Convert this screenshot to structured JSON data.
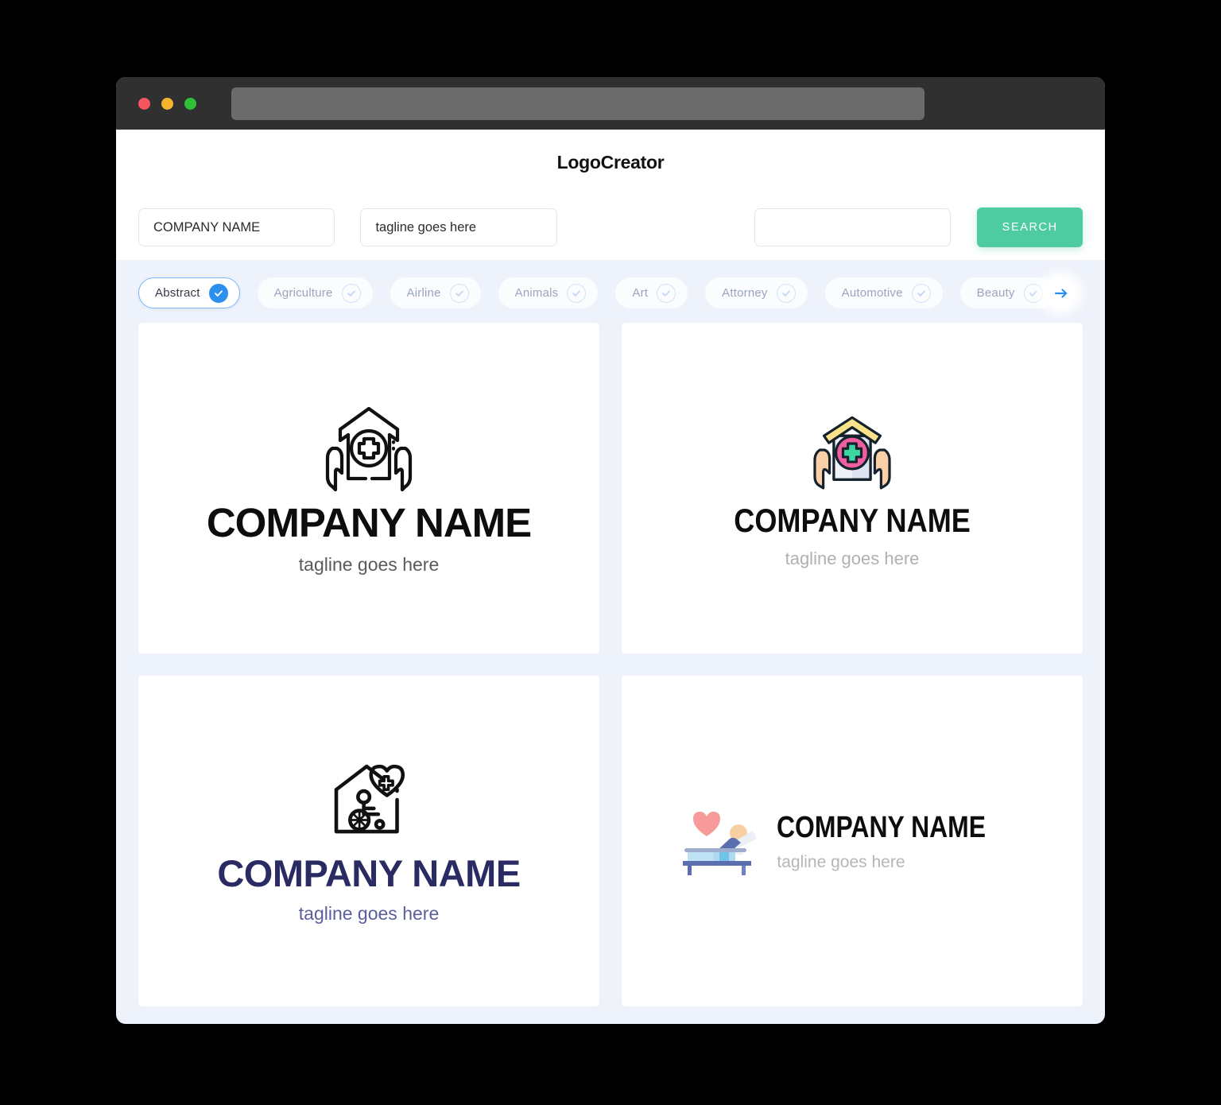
{
  "window": {
    "traffic_lights": [
      "close-red",
      "minimize-yellow",
      "maximize-green"
    ],
    "url_bar_value": ""
  },
  "header": {
    "brand": "LogoCreator"
  },
  "search": {
    "company_value": "COMPANY NAME",
    "tagline_value": "tagline goes here",
    "third_value": "",
    "search_label": "SEARCH",
    "accent_color": "#4ecba0"
  },
  "chips": {
    "selected_color": "#2b90f0",
    "items": [
      {
        "label": "Abstract",
        "selected": true
      },
      {
        "label": "Agriculture",
        "selected": false
      },
      {
        "label": "Airline",
        "selected": false
      },
      {
        "label": "Animals",
        "selected": false
      },
      {
        "label": "Art",
        "selected": false
      },
      {
        "label": "Attorney",
        "selected": false
      },
      {
        "label": "Automotive",
        "selected": false
      },
      {
        "label": "Beauty",
        "selected": false
      }
    ],
    "next_icon": "arrow-right-icon"
  },
  "logos": [
    {
      "icon": "house-hands-medical-cross-outline-icon",
      "company": "COMPANY NAME",
      "tagline": "tagline goes here",
      "layout": "stacked",
      "name_color": "#0d0d0d",
      "tagline_color": "#5a5a5a"
    },
    {
      "icon": "house-hands-medical-cross-color-icon",
      "company": "COMPANY NAME",
      "tagline": "tagline goes here",
      "layout": "stacked",
      "name_color": "#0d0d0d",
      "tagline_color": "#b0b0b0"
    },
    {
      "icon": "house-wheelchair-heart-outline-icon",
      "company": "COMPANY NAME",
      "tagline": "tagline goes here",
      "layout": "stacked",
      "name_color": "#2b2b63",
      "tagline_color": "#5a5f9c"
    },
    {
      "icon": "hospital-bed-patient-heart-icon",
      "company": "COMPANY NAME",
      "tagline": "tagline goes here",
      "layout": "horizontal",
      "name_color": "#0d0d0d",
      "tagline_color": "#b6b6b6"
    }
  ]
}
